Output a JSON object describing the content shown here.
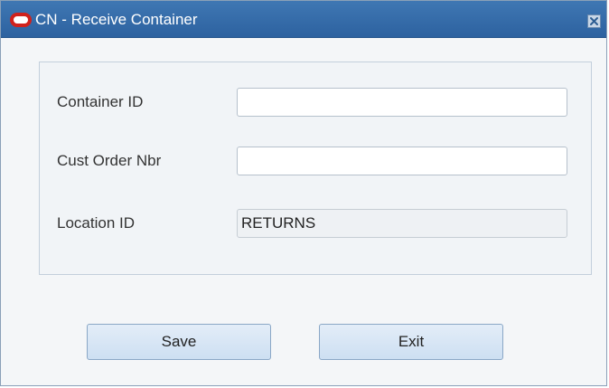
{
  "window": {
    "title": "CN - Receive Container",
    "logo_icon": "oracle-logo-icon",
    "close_icon": "close-icon",
    "title_bar_color": "#3a70ad"
  },
  "form": {
    "fields": [
      {
        "label": "Container ID",
        "value": "",
        "readonly": false
      },
      {
        "label": "Cust Order Nbr",
        "value": "",
        "readonly": false
      },
      {
        "label": "Location ID",
        "value": "RETURNS",
        "readonly": true
      }
    ]
  },
  "buttons": {
    "save_label": "Save",
    "exit_label": "Exit"
  }
}
